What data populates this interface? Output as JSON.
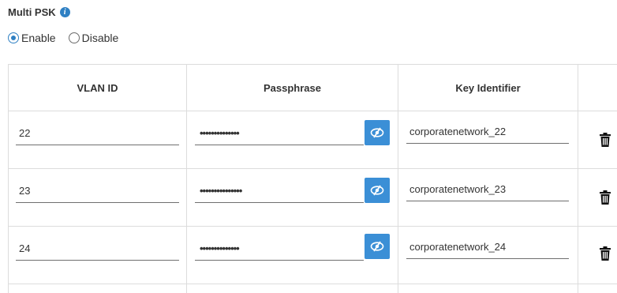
{
  "section": {
    "title": "Multi PSK",
    "info_icon": "info-icon"
  },
  "mode": {
    "options": [
      "Enable",
      "Disable"
    ],
    "selected": "Enable"
  },
  "table": {
    "headers": [
      "VLAN ID",
      "Passphrase",
      "Key Identifier"
    ],
    "rows": [
      {
        "vlan": "22",
        "passphrase": "••••••••••••••",
        "key": "corporatenetwork_22"
      },
      {
        "vlan": "23",
        "passphrase": "•••••••••••••••",
        "key": "corporatenetwork_23"
      },
      {
        "vlan": "24",
        "passphrase": "••••••••••••••",
        "key": "corporatenetwork_24"
      }
    ]
  },
  "colors": {
    "accent": "#3b8fd6",
    "info": "#2f80c3",
    "border": "#dcdcdc"
  },
  "icons": {
    "reveal": "eye-slash-icon",
    "delete": "trash-icon"
  }
}
